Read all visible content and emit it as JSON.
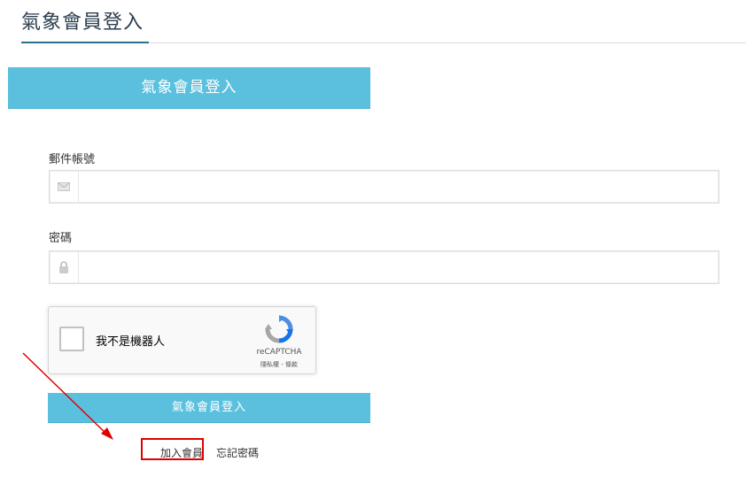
{
  "header": {
    "title": "氣象會員登入"
  },
  "banner": {
    "label": "氣象會員登入"
  },
  "form": {
    "email_label": "郵件帳號",
    "email_value": "",
    "email_placeholder": "",
    "password_label": "密碼",
    "password_value": "",
    "password_placeholder": "",
    "submit_label": "氣象會員登入"
  },
  "recaptcha": {
    "label": "我不是機器人",
    "checked": false,
    "brand": "reCAPTCHA",
    "terms": "隱私權 - 條款"
  },
  "links": {
    "join_label": "加入會員",
    "forgot_label": "忘記密碼"
  },
  "icons": {
    "email": "envelope-icon",
    "password": "lock-icon",
    "recaptcha": "recaptcha-logo-icon",
    "annotation": "red-arrow-icon"
  },
  "colors": {
    "accent": "#5bc0de",
    "title_underline": "#2b6f8c",
    "annotation": "#e00000"
  }
}
